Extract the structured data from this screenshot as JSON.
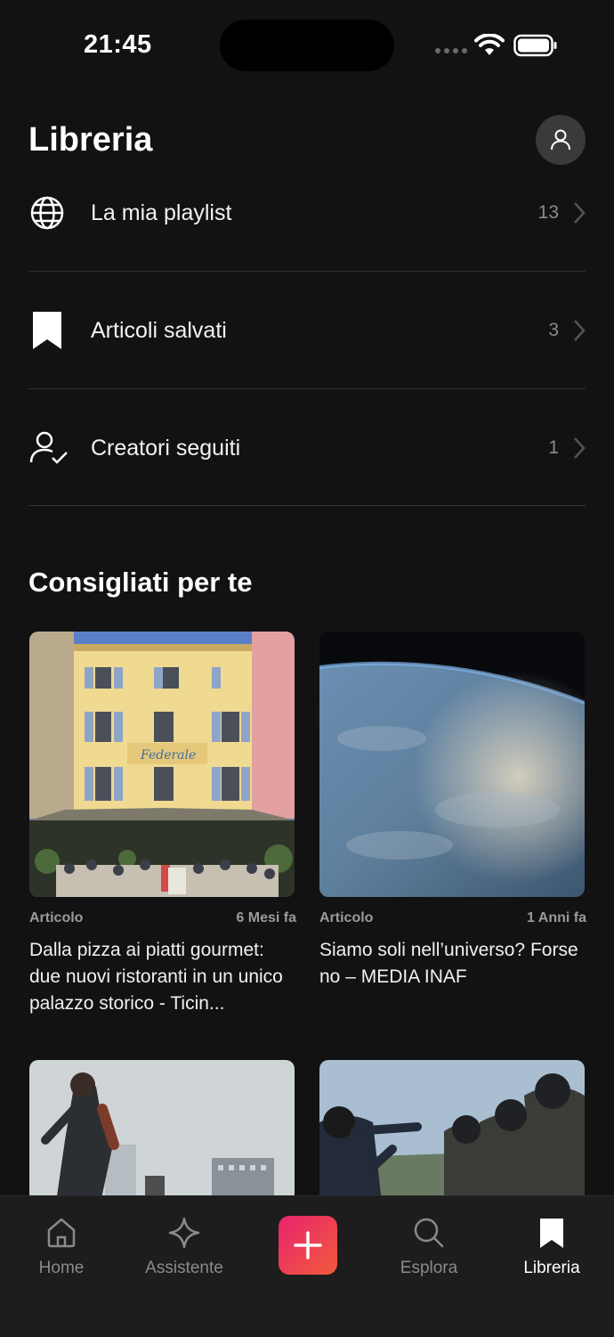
{
  "status_bar": {
    "time": "21:45"
  },
  "header": {
    "title": "Libreria"
  },
  "library_items": [
    {
      "label": "La mia playlist",
      "count": "13",
      "icon": "globe-icon"
    },
    {
      "label": "Articoli salvati",
      "count": "3",
      "icon": "bookmark-icon"
    },
    {
      "label": "Creatori seguiti",
      "count": "1",
      "icon": "user-check-icon"
    }
  ],
  "recommended": {
    "title": "Consigliati per te",
    "cards": [
      {
        "type": "Articolo",
        "age": "6 Mesi fa",
        "title": "Dalla pizza ai piatti gourmet: due nuovi ristoranti in un unico palazzo storico - Ticin..."
      },
      {
        "type": "Articolo",
        "age": "1 Anni fa",
        "title": "Siamo soli nell’universo? Forse no – MEDIA INAF"
      }
    ]
  },
  "tabbar": {
    "items": [
      {
        "label": "Home",
        "icon": "home-icon"
      },
      {
        "label": "Assistente",
        "icon": "sparkle-icon"
      },
      {
        "label": "",
        "icon": "plus-icon"
      },
      {
        "label": "Esplora",
        "icon": "search-icon"
      },
      {
        "label": "Libreria",
        "icon": "bookmark-icon"
      }
    ],
    "active": "Libreria"
  },
  "colors": {
    "background": "#121212",
    "accent_start": "#e8246f",
    "accent_end": "#f25a3a"
  }
}
